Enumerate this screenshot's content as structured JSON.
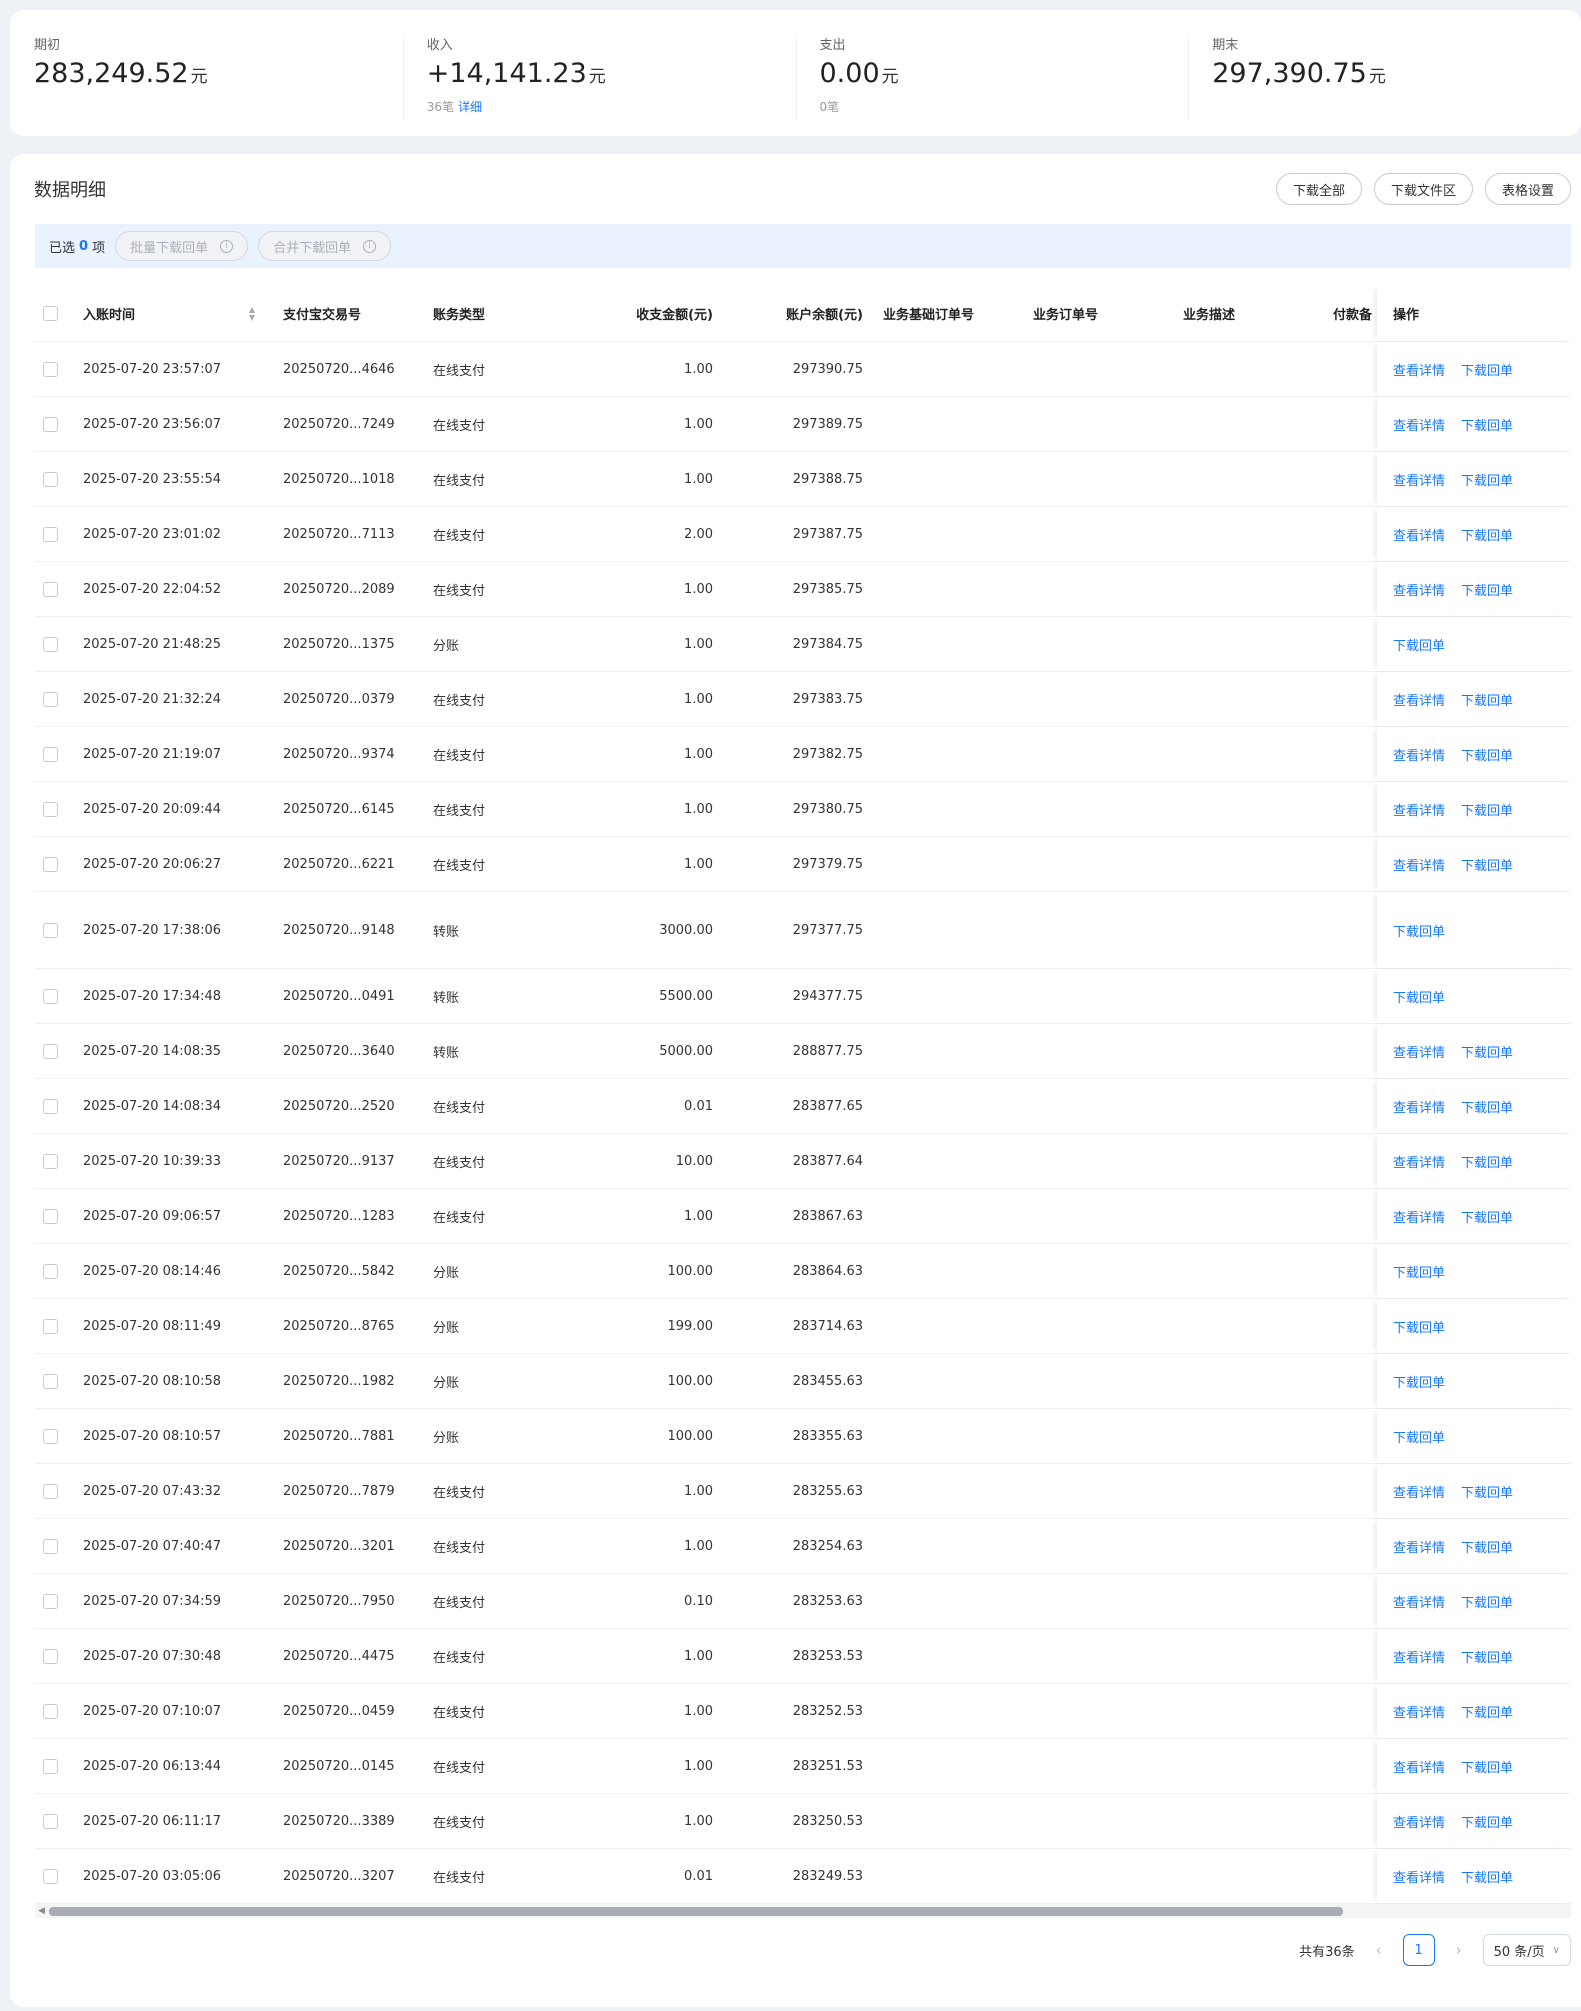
{
  "summary": [
    {
      "label": "期初",
      "value": "283,249.52",
      "unit": "元",
      "count": "",
      "link": ""
    },
    {
      "label": "收入",
      "value": "+14,141.23",
      "unit": "元",
      "count": "36笔",
      "link": "详细"
    },
    {
      "label": "支出",
      "value": "0.00",
      "unit": "元",
      "count": "0笔",
      "link": ""
    },
    {
      "label": "期末",
      "value": "297,390.75",
      "unit": "元",
      "count": "",
      "link": ""
    }
  ],
  "detail": {
    "title": "数据明细",
    "buttons": {
      "download_all": "下载全部",
      "download_files": "下载文件区",
      "table_settings": "表格设置"
    }
  },
  "selection": {
    "prefix": "已选",
    "count": "0",
    "suffix": "项",
    "batch_download": "批量下载回单",
    "merge_download": "合并下载回单"
  },
  "table": {
    "headers": {
      "time": "入账时间",
      "trade_no": "支付宝交易号",
      "type": "账务类型",
      "amount": "收支金额(元)",
      "balance": "账户余额(元)",
      "base_order": "业务基础订单号",
      "order": "业务订单号",
      "desc": "业务描述",
      "payer": "付款备",
      "ops": "操作"
    },
    "actions": {
      "view": "查看详情",
      "download": "下载回单"
    },
    "rows": [
      {
        "time": "2025-07-20 23:57:07",
        "trade": "20250720...4646",
        "type": "在线支付",
        "amount": "1.00",
        "balance": "297390.75",
        "view": true
      },
      {
        "time": "2025-07-20 23:56:07",
        "trade": "20250720...7249",
        "type": "在线支付",
        "amount": "1.00",
        "balance": "297389.75",
        "view": true
      },
      {
        "time": "2025-07-20 23:55:54",
        "trade": "20250720...1018",
        "type": "在线支付",
        "amount": "1.00",
        "balance": "297388.75",
        "view": true
      },
      {
        "time": "2025-07-20 23:01:02",
        "trade": "20250720...7113",
        "type": "在线支付",
        "amount": "2.00",
        "balance": "297387.75",
        "view": true
      },
      {
        "time": "2025-07-20 22:04:52",
        "trade": "20250720...2089",
        "type": "在线支付",
        "amount": "1.00",
        "balance": "297385.75",
        "view": true
      },
      {
        "time": "2025-07-20 21:48:25",
        "trade": "20250720...1375",
        "type": "分账",
        "amount": "1.00",
        "balance": "297384.75",
        "view": false
      },
      {
        "time": "2025-07-20 21:32:24",
        "trade": "20250720...0379",
        "type": "在线支付",
        "amount": "1.00",
        "balance": "297383.75",
        "view": true
      },
      {
        "time": "2025-07-20 21:19:07",
        "trade": "20250720...9374",
        "type": "在线支付",
        "amount": "1.00",
        "balance": "297382.75",
        "view": true
      },
      {
        "time": "2025-07-20 20:09:44",
        "trade": "20250720...6145",
        "type": "在线支付",
        "amount": "1.00",
        "balance": "297380.75",
        "view": true
      },
      {
        "time": "2025-07-20 20:06:27",
        "trade": "20250720...6221",
        "type": "在线支付",
        "amount": "1.00",
        "balance": "297379.75",
        "view": true
      },
      {
        "time": "2025-07-20 17:38:06",
        "trade": "20250720...9148",
        "type": "转账",
        "amount": "3000.00",
        "balance": "297377.75",
        "view": false,
        "tall": true
      },
      {
        "time": "2025-07-20 17:34:48",
        "trade": "20250720...0491",
        "type": "转账",
        "amount": "5500.00",
        "balance": "294377.75",
        "view": false
      },
      {
        "time": "2025-07-20 14:08:35",
        "trade": "20250720...3640",
        "type": "转账",
        "amount": "5000.00",
        "balance": "288877.75",
        "view": true
      },
      {
        "time": "2025-07-20 14:08:34",
        "trade": "20250720...2520",
        "type": "在线支付",
        "amount": "0.01",
        "balance": "283877.65",
        "view": true
      },
      {
        "time": "2025-07-20 10:39:33",
        "trade": "20250720...9137",
        "type": "在线支付",
        "amount": "10.00",
        "balance": "283877.64",
        "view": true
      },
      {
        "time": "2025-07-20 09:06:57",
        "trade": "20250720...1283",
        "type": "在线支付",
        "amount": "1.00",
        "balance": "283867.63",
        "view": true
      },
      {
        "time": "2025-07-20 08:14:46",
        "trade": "20250720...5842",
        "type": "分账",
        "amount": "100.00",
        "balance": "283864.63",
        "view": false
      },
      {
        "time": "2025-07-20 08:11:49",
        "trade": "20250720...8765",
        "type": "分账",
        "amount": "199.00",
        "balance": "283714.63",
        "view": false
      },
      {
        "time": "2025-07-20 08:10:58",
        "trade": "20250720...1982",
        "type": "分账",
        "amount": "100.00",
        "balance": "283455.63",
        "view": false
      },
      {
        "time": "2025-07-20 08:10:57",
        "trade": "20250720...7881",
        "type": "分账",
        "amount": "100.00",
        "balance": "283355.63",
        "view": false
      },
      {
        "time": "2025-07-20 07:43:32",
        "trade": "20250720...7879",
        "type": "在线支付",
        "amount": "1.00",
        "balance": "283255.63",
        "view": true
      },
      {
        "time": "2025-07-20 07:40:47",
        "trade": "20250720...3201",
        "type": "在线支付",
        "amount": "1.00",
        "balance": "283254.63",
        "view": true
      },
      {
        "time": "2025-07-20 07:34:59",
        "trade": "20250720...7950",
        "type": "在线支付",
        "amount": "0.10",
        "balance": "283253.63",
        "view": true
      },
      {
        "time": "2025-07-20 07:30:48",
        "trade": "20250720...4475",
        "type": "在线支付",
        "amount": "1.00",
        "balance": "283253.53",
        "view": true
      },
      {
        "time": "2025-07-20 07:10:07",
        "trade": "20250720...0459",
        "type": "在线支付",
        "amount": "1.00",
        "balance": "283252.53",
        "view": true
      },
      {
        "time": "2025-07-20 06:13:44",
        "trade": "20250720...0145",
        "type": "在线支付",
        "amount": "1.00",
        "balance": "283251.53",
        "view": true
      },
      {
        "time": "2025-07-20 06:11:17",
        "trade": "20250720...3389",
        "type": "在线支付",
        "amount": "1.00",
        "balance": "283250.53",
        "view": true
      },
      {
        "time": "2025-07-20 03:05:06",
        "trade": "20250720...3207",
        "type": "在线支付",
        "amount": "0.01",
        "balance": "283249.53",
        "view": true
      }
    ]
  },
  "pagination": {
    "total": "共有36条",
    "current_page": "1",
    "page_size": "50 条/页"
  }
}
